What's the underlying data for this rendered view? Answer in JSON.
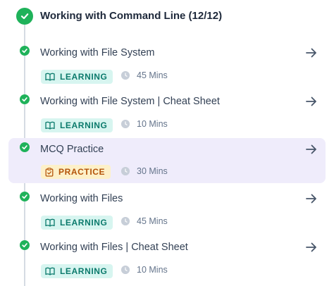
{
  "section": {
    "title": "Working with Command Line (12/12)"
  },
  "items": [
    {
      "title": "Working with File System",
      "type": "LEARNING",
      "duration": "45 Mins"
    },
    {
      "title": "Working with File System | Cheat Sheet",
      "type": "LEARNING",
      "duration": "10 Mins"
    },
    {
      "title": "MCQ Practice",
      "type": "PRACTICE",
      "duration": "30 Mins"
    },
    {
      "title": "Working with Files",
      "type": "LEARNING",
      "duration": "45 Mins"
    },
    {
      "title": "Working with Files | Cheat Sheet",
      "type": "LEARNING",
      "duration": "10 Mins"
    }
  ],
  "colors": {
    "check_green": "#1fb25a",
    "active_bg": "#efecfb",
    "learning_bg": "#d7f5f0",
    "learning_text": "#0b7a6c",
    "practice_bg": "#fdf0c8",
    "practice_text": "#b45309"
  },
  "icons": {
    "complete": "check-circle-icon",
    "next": "arrow-right-icon",
    "learning": "book-open-icon",
    "practice": "clipboard-check-icon",
    "duration": "clock-icon"
  }
}
